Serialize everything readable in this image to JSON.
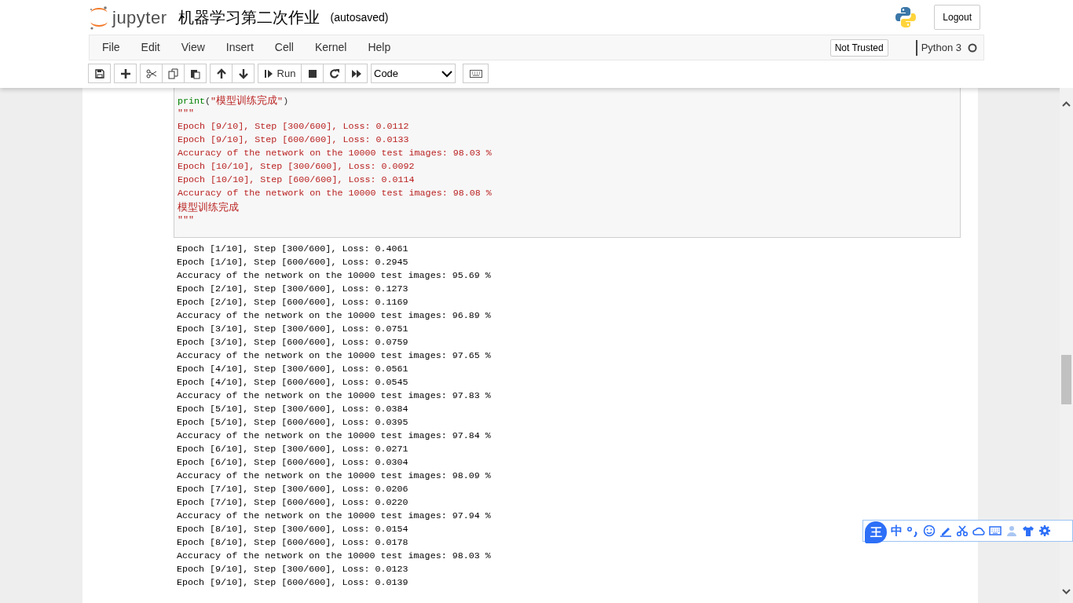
{
  "header": {
    "logo_text": "jupyter",
    "notebook_name": "机器学习第二次作业",
    "save_status": "(autosaved)",
    "logout": "Logout"
  },
  "menubar": {
    "items": [
      "File",
      "Edit",
      "View",
      "Insert",
      "Cell",
      "Kernel",
      "Help"
    ],
    "trust": "Not Trusted",
    "kernel": "Python 3",
    "kernel_busy": false
  },
  "toolbar": {
    "groups": [
      [
        {
          "kind": "save"
        }
      ],
      [
        {
          "kind": "add"
        }
      ],
      [
        {
          "kind": "cut"
        },
        {
          "kind": "copy"
        },
        {
          "kind": "paste"
        }
      ],
      [
        {
          "kind": "up"
        },
        {
          "kind": "down"
        }
      ],
      [
        {
          "kind": "run",
          "label": "Run"
        },
        {
          "kind": "stop"
        },
        {
          "kind": "restart"
        },
        {
          "kind": "run-all"
        }
      ],
      [
        {
          "kind": "select",
          "value": "Code"
        }
      ],
      [
        {
          "kind": "keyboard"
        }
      ]
    ]
  },
  "cell_input": {
    "lines": [
      [
        {
          "kind": "builtin",
          "text": "print"
        },
        {
          "kind": "plain",
          "text": "("
        },
        {
          "kind": "string",
          "text": "\"模型训练完成\""
        },
        {
          "kind": "plain",
          "text": ")"
        }
      ],
      [
        {
          "kind": "string",
          "text": "\"\"\""
        }
      ],
      [
        {
          "kind": "string",
          "text": "Epoch [9/10], Step [300/600], Loss: 0.0112"
        }
      ],
      [
        {
          "kind": "string",
          "text": "Epoch [9/10], Step [600/600], Loss: 0.0133"
        }
      ],
      [
        {
          "kind": "string",
          "text": "Accuracy of the network on the 10000 test images: 98.03 %"
        }
      ],
      [
        {
          "kind": "string",
          "text": "Epoch [10/10], Step [300/600], Loss: 0.0092"
        }
      ],
      [
        {
          "kind": "string",
          "text": "Epoch [10/10], Step [600/600], Loss: 0.0114"
        }
      ],
      [
        {
          "kind": "string",
          "text": "Accuracy of the network on the 10000 test images: 98.08 %"
        }
      ],
      [
        {
          "kind": "string",
          "text": "模型训练完成"
        }
      ],
      [
        {
          "kind": "string",
          "text": "\"\"\""
        }
      ]
    ]
  },
  "cell_output": {
    "lines": [
      "Epoch [1/10], Step [300/600], Loss: 0.4061",
      "Epoch [1/10], Step [600/600], Loss: 0.2945",
      "Accuracy of the network on the 10000 test images: 95.69 %",
      "Epoch [2/10], Step [300/600], Loss: 0.1273",
      "Epoch [2/10], Step [600/600], Loss: 0.1169",
      "Accuracy of the network on the 10000 test images: 96.89 %",
      "Epoch [3/10], Step [300/600], Loss: 0.0751",
      "Epoch [3/10], Step [600/600], Loss: 0.0759",
      "Accuracy of the network on the 10000 test images: 97.65 %",
      "Epoch [4/10], Step [300/600], Loss: 0.0561",
      "Epoch [4/10], Step [600/600], Loss: 0.0545",
      "Accuracy of the network on the 10000 test images: 97.83 %",
      "Epoch [5/10], Step [300/600], Loss: 0.0384",
      "Epoch [5/10], Step [600/600], Loss: 0.0395",
      "Accuracy of the network on the 10000 test images: 97.84 %",
      "Epoch [6/10], Step [300/600], Loss: 0.0271",
      "Epoch [6/10], Step [600/600], Loss: 0.0304",
      "Accuracy of the network on the 10000 test images: 98.09 %",
      "Epoch [7/10], Step [300/600], Loss: 0.0206",
      "Epoch [7/10], Step [600/600], Loss: 0.0220",
      "Accuracy of the network on the 10000 test images: 97.94 %",
      "Epoch [8/10], Step [300/600], Loss: 0.0154",
      "Epoch [8/10], Step [600/600], Loss: 0.0178",
      "Accuracy of the network on the 10000 test images: 98.03 %",
      "Epoch [9/10], Step [300/600], Loss: 0.0123",
      "Epoch [9/10], Step [600/600], Loss: 0.0139"
    ]
  },
  "ime_toolbar": {
    "badge": "王",
    "mode": "中"
  }
}
